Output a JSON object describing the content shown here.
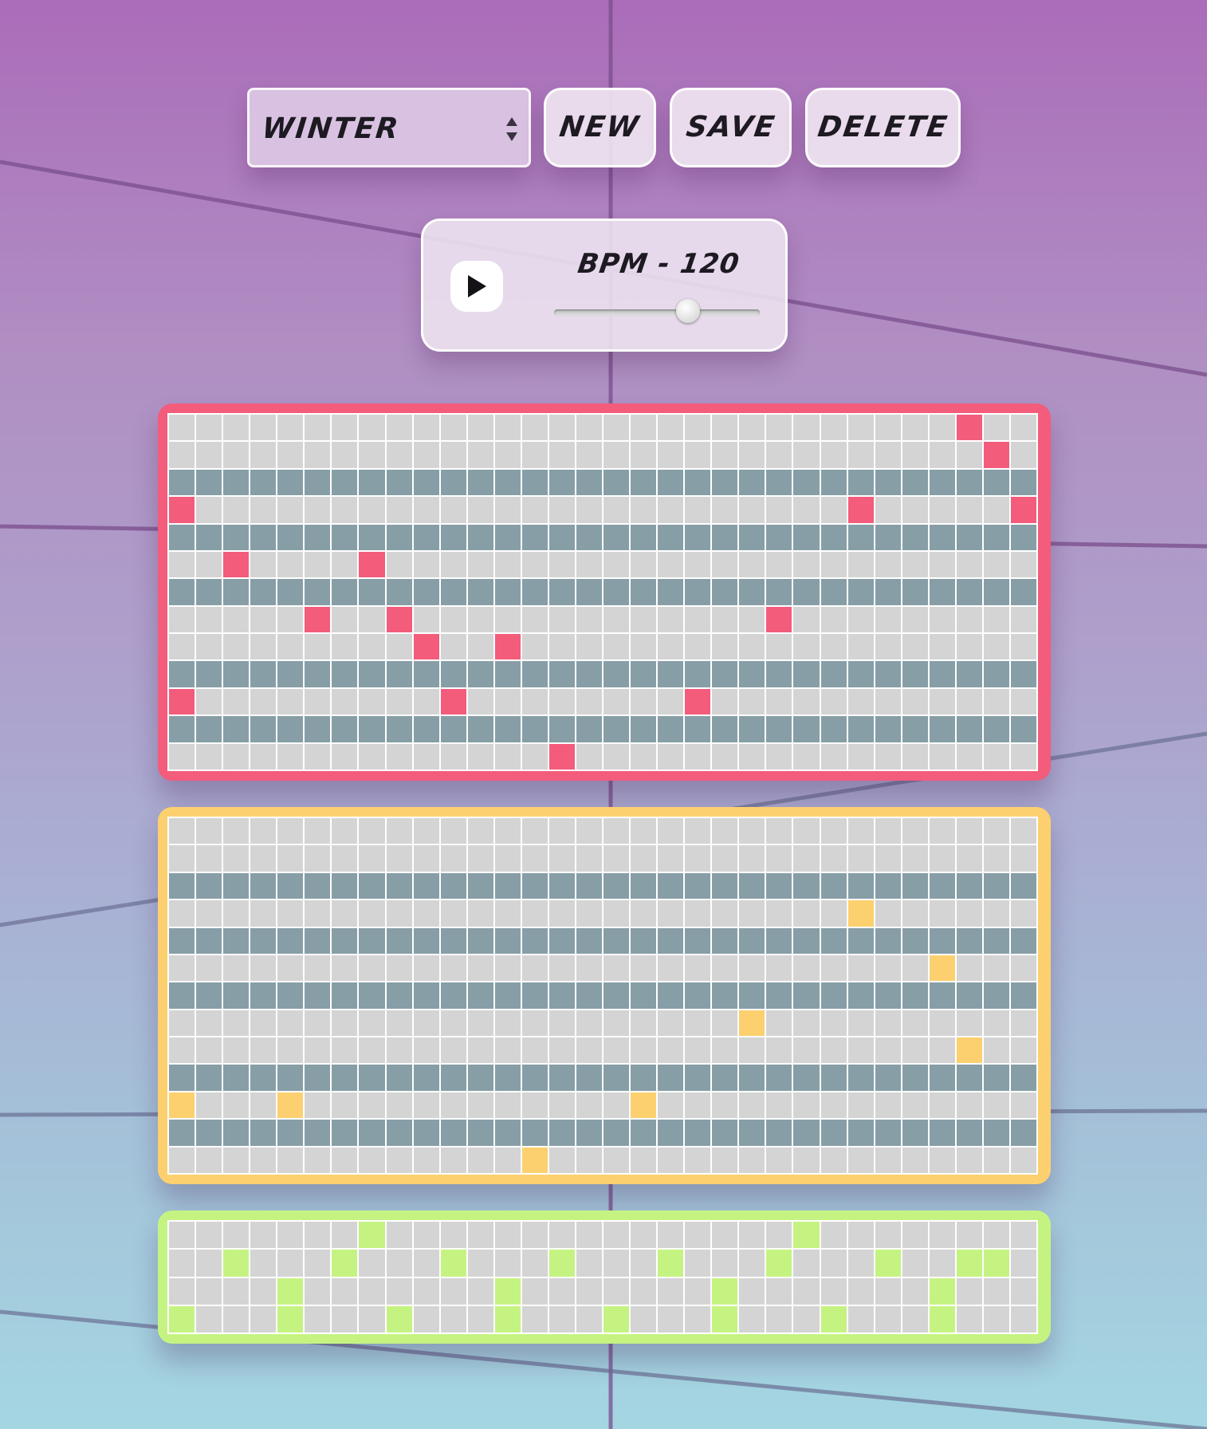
{
  "toolbar": {
    "preset_select_value": "WINTER",
    "new_label": "NEW",
    "save_label": "SAVE",
    "delete_label": "DELETE"
  },
  "transport": {
    "play_icon": "play-icon",
    "bpm_text": "BPM - 120",
    "tempo_value": 120,
    "tempo_slider_fraction": 0.65
  },
  "colors": {
    "melody": "#f35c7b",
    "bass": "#fcd06f",
    "drums": "#c5f382",
    "cell_off": "#d4d4d5",
    "cell_black_key": "#879ea7"
  },
  "sequencer": {
    "steps": 32,
    "melody": {
      "rows": 13,
      "black_key_rows": [
        2,
        4,
        6,
        9,
        11
      ],
      "active": [
        [
          0,
          29
        ],
        [
          1,
          30
        ],
        [
          3,
          0
        ],
        [
          3,
          25
        ],
        [
          3,
          31
        ],
        [
          5,
          2
        ],
        [
          5,
          7
        ],
        [
          7,
          5
        ],
        [
          7,
          8
        ],
        [
          7,
          22
        ],
        [
          8,
          9
        ],
        [
          8,
          12
        ],
        [
          10,
          0
        ],
        [
          10,
          10
        ],
        [
          10,
          19
        ],
        [
          12,
          14
        ]
      ]
    },
    "bass": {
      "rows": 13,
      "black_key_rows": [
        2,
        4,
        6,
        9,
        11
      ],
      "active": [
        [
          3,
          25
        ],
        [
          5,
          28
        ],
        [
          7,
          21
        ],
        [
          8,
          29
        ],
        [
          10,
          0
        ],
        [
          10,
          4
        ],
        [
          10,
          17
        ],
        [
          12,
          13
        ]
      ]
    },
    "drums": {
      "rows": 4,
      "black_key_rows": [],
      "active": [
        [
          0,
          7
        ],
        [
          0,
          23
        ],
        [
          1,
          2
        ],
        [
          1,
          6
        ],
        [
          1,
          10
        ],
        [
          1,
          14
        ],
        [
          1,
          18
        ],
        [
          1,
          22
        ],
        [
          1,
          26
        ],
        [
          1,
          29
        ],
        [
          1,
          30
        ],
        [
          2,
          4
        ],
        [
          2,
          12
        ],
        [
          2,
          20
        ],
        [
          2,
          28
        ],
        [
          3,
          0
        ],
        [
          3,
          4
        ],
        [
          3,
          8
        ],
        [
          3,
          12
        ],
        [
          3,
          16
        ],
        [
          3,
          20
        ],
        [
          3,
          24
        ],
        [
          3,
          28
        ]
      ]
    }
  }
}
